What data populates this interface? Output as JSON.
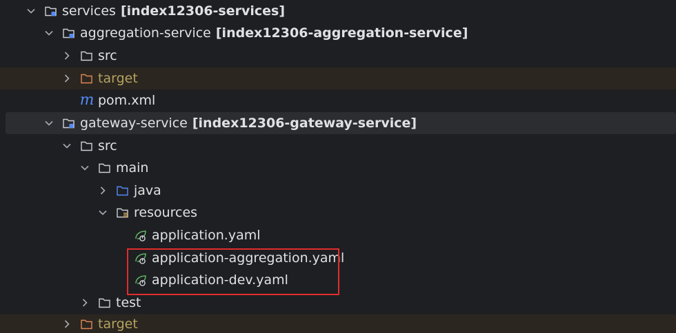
{
  "tree": {
    "rows": [
      {
        "label": "services",
        "module": "[index12306-services]"
      },
      {
        "label": "aggregation-service",
        "module": "[index12306-aggregation-service]"
      },
      {
        "label": "src"
      },
      {
        "label": "target"
      },
      {
        "label": "pom.xml"
      },
      {
        "label": "gateway-service",
        "module": "[index12306-gateway-service]"
      },
      {
        "label": "src"
      },
      {
        "label": "main"
      },
      {
        "label": "java"
      },
      {
        "label": "resources"
      },
      {
        "label": "application.yaml"
      },
      {
        "label": "application-aggregation.yaml"
      },
      {
        "label": "application-dev.yaml"
      },
      {
        "label": "test"
      },
      {
        "label": "target"
      }
    ]
  },
  "icons": {
    "chevron": "chevron-icon",
    "module_folder": "module-folder-icon",
    "folder": "folder-icon",
    "source_folder": "source-folder-icon",
    "resources_folder": "resources-folder-icon",
    "excluded_folder": "excluded-folder-icon",
    "maven": "maven-icon",
    "spring_yaml": "spring-yaml-icon",
    "maven_glyph": "m"
  },
  "colors": {
    "background": "#1e1f22",
    "excluded_row": "#2b2620",
    "selected_row": "#2b2d30",
    "text": "#dfe1e5",
    "excluded_text": "#b5a35f",
    "java_folder": "#548af7",
    "spring_green": "#5fb865",
    "highlight_border": "#e22c2c"
  }
}
